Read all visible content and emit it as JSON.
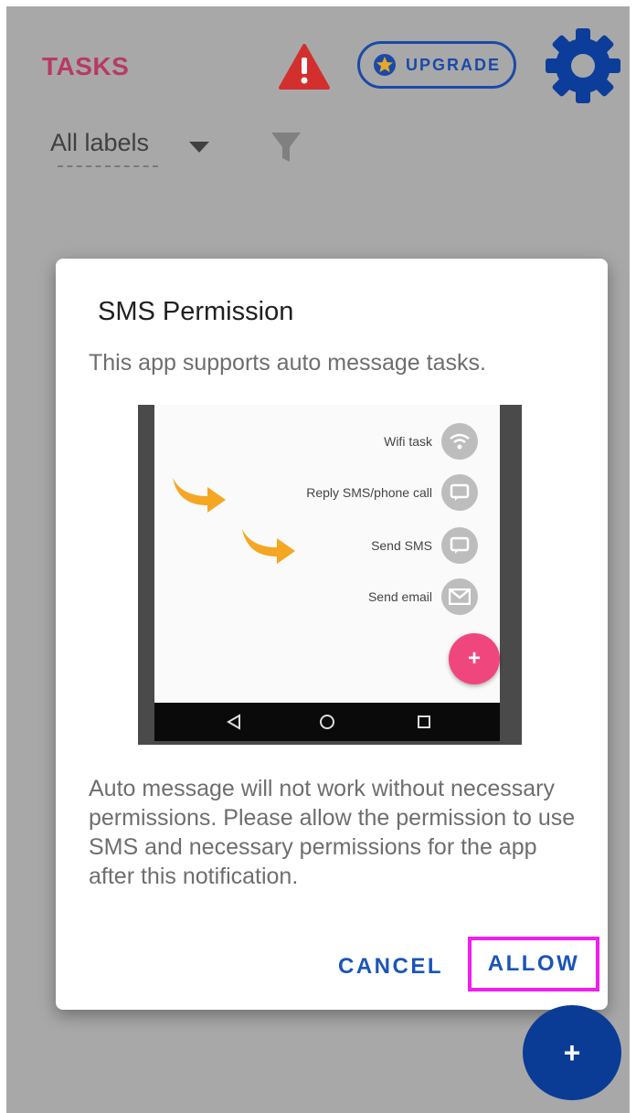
{
  "header": {
    "title": "TASKS",
    "upgrade_label": "UPGRADE",
    "labels_select": "All labels"
  },
  "dialog": {
    "title": "SMS Permission",
    "message": "This app supports auto message tasks.",
    "illustration": {
      "items": [
        {
          "label": "Wifi task",
          "icon": "wifi-icon"
        },
        {
          "label": "Reply SMS/phone call",
          "icon": "message-icon"
        },
        {
          "label": "Send SMS",
          "icon": "message-icon"
        },
        {
          "label": "Send email",
          "icon": "email-icon"
        }
      ],
      "fab_label": "+"
    },
    "body": "Auto message will not work without necessary permissions. Please allow the permission to use SMS and necessary permissions for the app after this notification.",
    "cancel_label": "CANCEL",
    "allow_label": "ALLOW"
  },
  "fab": {
    "label": "+"
  },
  "colors": {
    "title": "#b83a62",
    "accent": "#1a4aa8",
    "warning": "#d32f2f",
    "highlight": "#f01ef0",
    "fab": "#0a3c96",
    "pink_fab": "#f0467e"
  }
}
